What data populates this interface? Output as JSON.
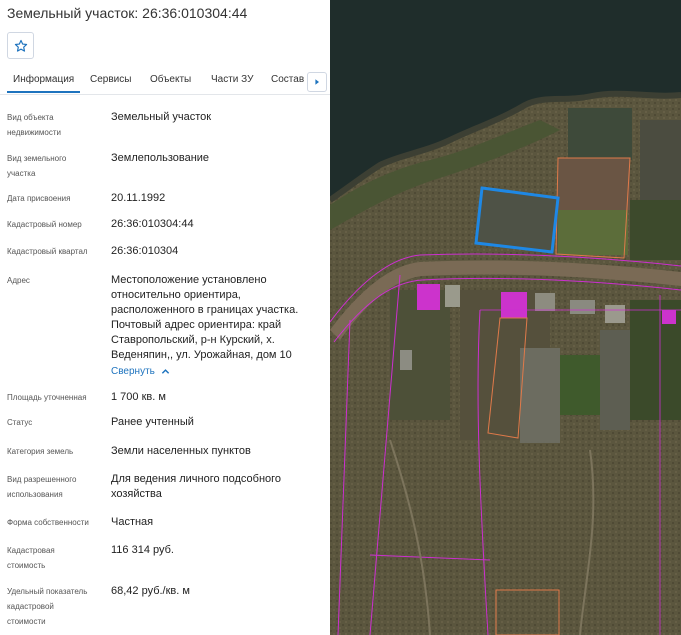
{
  "panel": {
    "title": "Земельный участок: 26:36:010304:44",
    "favorite_icon": "star-icon",
    "tabs": [
      "Информация",
      "Сервисы",
      "Объекты",
      "Части ЗУ",
      "Состав"
    ],
    "tabs_next_icon": "chevron-right-icon",
    "fields": {
      "object_type": {
        "label": "Вид объекта недвижимости",
        "value": "Земельный участок"
      },
      "land_use_type": {
        "label": "Вид земельного участка",
        "value": "Землепользование"
      },
      "assign_date": {
        "label": "Дата присвоения",
        "value": "20.11.1992"
      },
      "cadastral_number": {
        "label": "Кадастровый номер",
        "value": "26:36:010304:44"
      },
      "cadastral_quarter": {
        "label": "Кадастровый квартал",
        "value": "26:36:010304"
      },
      "address": {
        "label": "Адрес",
        "value_lines": [
          "Местоположение установлено",
          "относительно ориентира,",
          "расположенного в границах участка.",
          "Почтовый адрес ориентира: край",
          "Ставропольский, р-н Курский, х.",
          "Веденяпин,, ул. Урожайная, дом 10"
        ],
        "collapse_label": "Свернуть"
      },
      "area": {
        "label": "Площадь уточненная",
        "value": "1 700 кв. м"
      },
      "status": {
        "label": "Статус",
        "value": "Ранее учтенный"
      },
      "land_category": {
        "label": "Категория земель",
        "value": "Земли населенных пунктов"
      },
      "permitted_use": {
        "label_lines": [
          "Вид разрешенного",
          "использования"
        ],
        "value_lines": [
          "Для ведения личного подсобного",
          "хозяйства"
        ]
      },
      "ownership": {
        "label": "Форма собственности",
        "value": "Частная"
      },
      "cadastral_value": {
        "label_lines": [
          "Кадастровая",
          "стоимость"
        ],
        "value": "116 314 руб."
      },
      "specific_value": {
        "label_lines": [
          "Удельный показатель",
          "кадастровой",
          "стоимости"
        ],
        "value": "68,42 руб./кв. м"
      }
    }
  },
  "map": {
    "selected_parcel_color": "#1e88e5",
    "parcel_border_color": "#e07a4a",
    "boundary_color": "#cc2fd0"
  }
}
